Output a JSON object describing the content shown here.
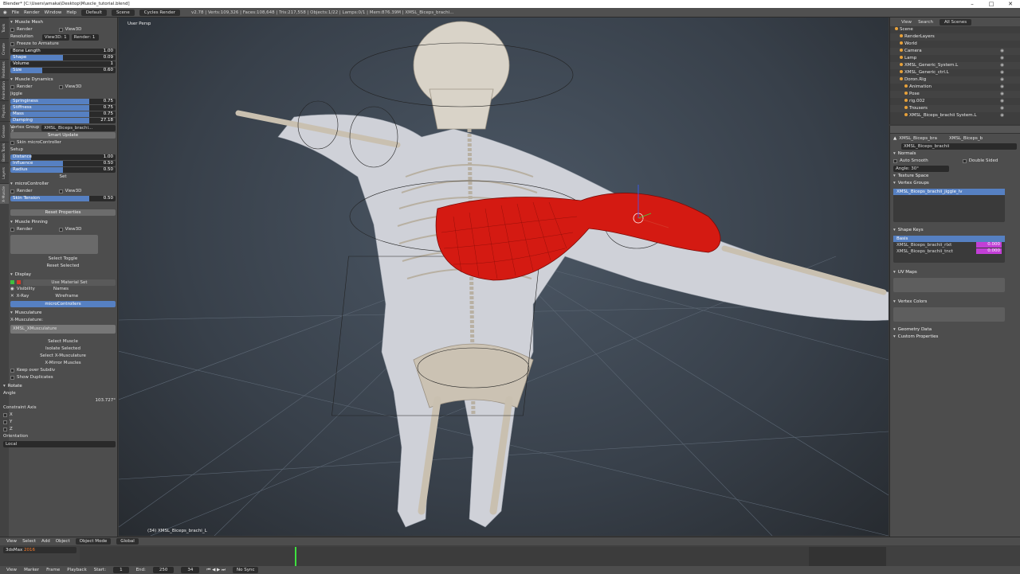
{
  "window": {
    "title": "Blender* [C:\\Users\\amaka\\Desktop\\Muscle_tutorial.blend]",
    "controls": [
      "–",
      "□",
      "✕"
    ]
  },
  "infobar": {
    "menus": [
      "File",
      "Render",
      "Window",
      "Help"
    ],
    "layout": "Default",
    "scene": "Scene",
    "engine": "Cycles Render",
    "stats": "v2.78 | Verts:109,326 | Faces:108,648 | Tris:217,558 | Objects:1/22 | Lamps:0/1 | Mem:876.39M | XMSL_Biceps_brachi..."
  },
  "left_tabs": [
    "Tools",
    "Create",
    "Relations",
    "Animation",
    "Physics",
    "Grease Pencil",
    "Bass Tools",
    "Layers",
    "X-Muscle"
  ],
  "left": {
    "muscle_mesh": {
      "header": "Muscle Mesh",
      "render": "Render",
      "view3d": "View3D",
      "resolution": "Resolution",
      "res_view": "View3D: 1",
      "res_render": "Render: 1",
      "freeze": "Freeze to Armature"
    },
    "sliders1": [
      {
        "label": "Bone Length",
        "value": "1.00",
        "fill": 0
      },
      {
        "label": "Shape",
        "value": "0.09",
        "fill": 0.5
      },
      {
        "label": "Volume",
        "value": "1",
        "fill": 0
      },
      {
        "label": "Size",
        "value": "0.60",
        "fill": 0.3
      }
    ],
    "dynamics": {
      "header": "Muscle Dynamics",
      "render": "Render",
      "view3d": "View3D",
      "jiggle": "Jiggle"
    },
    "sliders2": [
      {
        "label": "Springiness",
        "value": "0.75",
        "fill": 0.75
      },
      {
        "label": "Stiffness",
        "value": "0.75",
        "fill": 0.75
      },
      {
        "label": "Mass",
        "value": "0.75",
        "fill": 0.75
      },
      {
        "label": "Damping",
        "value": "27.18",
        "fill": 0.75
      }
    ],
    "vertex_group": {
      "label": "Vertex Group",
      "value": "XMSL_Biceps_brachi..."
    },
    "smart_update": "Smart Update",
    "skin_controller": "Skin microController",
    "setup": "Setup",
    "sliders3": [
      {
        "label": "Distance",
        "value": "1.00",
        "fill": 0.2
      },
      {
        "label": "Influence",
        "value": "0.50",
        "fill": 0.5
      },
      {
        "label": "Radius",
        "value": "0.50",
        "fill": 0.5
      }
    ],
    "set": "Set",
    "micro": {
      "header": "microController",
      "render": "Render",
      "view3d": "View3D",
      "skin_tension": "Skin Tension",
      "skin_tension_value": "0.50",
      "skin_tension_fill": 0.75
    },
    "reset": "Reset Properties",
    "pinning": {
      "header": "Muscle Pinning",
      "render": "Render",
      "view3d": "View3D",
      "select_toggle": "Select Toggle",
      "reset_selected": "Reset Selected"
    },
    "display": {
      "header": "Display",
      "use_material": "Use Material Set",
      "visibility": "Visibility",
      "names": "Names",
      "xray": "X-Ray",
      "wireframe": "Wireframe",
      "micro": "microControllers"
    },
    "musculature": {
      "header": "Musculature",
      "label": "X-Musculature:",
      "field": "XMSL_XMusculature",
      "select_muscle": "Select Muscle",
      "isolate": "Isolate Selected",
      "select_x": "Select X-Musculature",
      "mirror": "X-Mirror Muscles",
      "keep_subdiv": "Keep over Subdiv",
      "show_dup": "Show Duplicates"
    },
    "rotate": {
      "header": "Rotate",
      "angle": "Angle",
      "angle_value": "103.727°",
      "constraint": "Constraint Axis",
      "x": "X",
      "y": "Y",
      "z": "Z",
      "orientation": "Orientation",
      "orientation_value": "Local"
    }
  },
  "viewport": {
    "label": "User Persp",
    "object": "(34) XMSL_Biceps_brachi_L"
  },
  "outliner": {
    "view": "View",
    "search": "Search",
    "scope": "All Scenes",
    "items": [
      "Scene",
      "RenderLayers",
      "World",
      "Camera",
      "Lamp",
      "XMSL_Generic_System.L",
      "XMSL_Generic_ctrl.L",
      "Doron.Rig",
      "Animation",
      "Pose",
      "rig.002",
      "Trousers",
      "XMSL_Biceps_brachii System.L"
    ]
  },
  "properties": {
    "breadcrumb": [
      "XMSL_Biceps_bra",
      "XMSL_Biceps_b"
    ],
    "object_field": "XMSL_Biceps_brachii",
    "normals": {
      "header": "Normals",
      "auto_smooth": "Auto Smooth",
      "double_sided": "Double Sided",
      "angle": "Angle: 30°"
    },
    "texture_space": "Texture Space",
    "vertex_groups": {
      "header": "Vertex Groups",
      "items": [
        "XMSL_Biceps_brachii_jiggle_lv"
      ]
    },
    "shape_keys": {
      "header": "Shape Keys",
      "items": [
        {
          "name": "Basis",
          "value": ""
        },
        {
          "name": "XMSL_Biceps_brachii_rlxt",
          "value": "0.000"
        },
        {
          "name": "XMSL_Biceps_brachii_tnct",
          "value": "0.000"
        }
      ]
    },
    "uv_maps": "UV Maps",
    "vertex_colors": "Vertex Colors",
    "geometry_data": "Geometry Data",
    "custom_props": "Custom Properties"
  },
  "timeline": {
    "menus": [
      "View",
      "Select",
      "Add",
      "Object"
    ],
    "mode": "Object Mode",
    "pivot": "Global",
    "info": "3dsMax",
    "info_hl": "2016",
    "footer": [
      "View",
      "Marker",
      "Frame",
      "Playback"
    ],
    "start_label": "Start:",
    "start": "1",
    "end_label": "End:",
    "end": "250",
    "current": "34",
    "sync": "No Sync"
  },
  "colors": {
    "muscle": "#d41a12",
    "selection": "#5680c2",
    "playhead": "#3fe03f",
    "accent": "#ff7d2a"
  }
}
